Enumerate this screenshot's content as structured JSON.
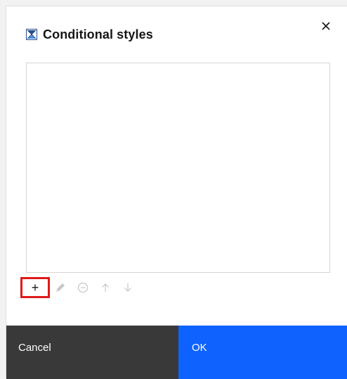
{
  "dialog": {
    "title": "Conditional styles",
    "title_icon": "conditional-styles-icon",
    "close_icon": "close-icon"
  },
  "toolbar": {
    "add_label": "+",
    "icons": [
      "add-icon",
      "edit-icon",
      "remove-icon",
      "move-up-icon",
      "move-down-icon"
    ]
  },
  "footer": {
    "cancel_label": "Cancel",
    "ok_label": "OK"
  },
  "colors": {
    "primary": "#0f62fe",
    "secondary": "#393939",
    "highlight": "#e01a1a",
    "icon_disabled": "#c6c6c6"
  }
}
